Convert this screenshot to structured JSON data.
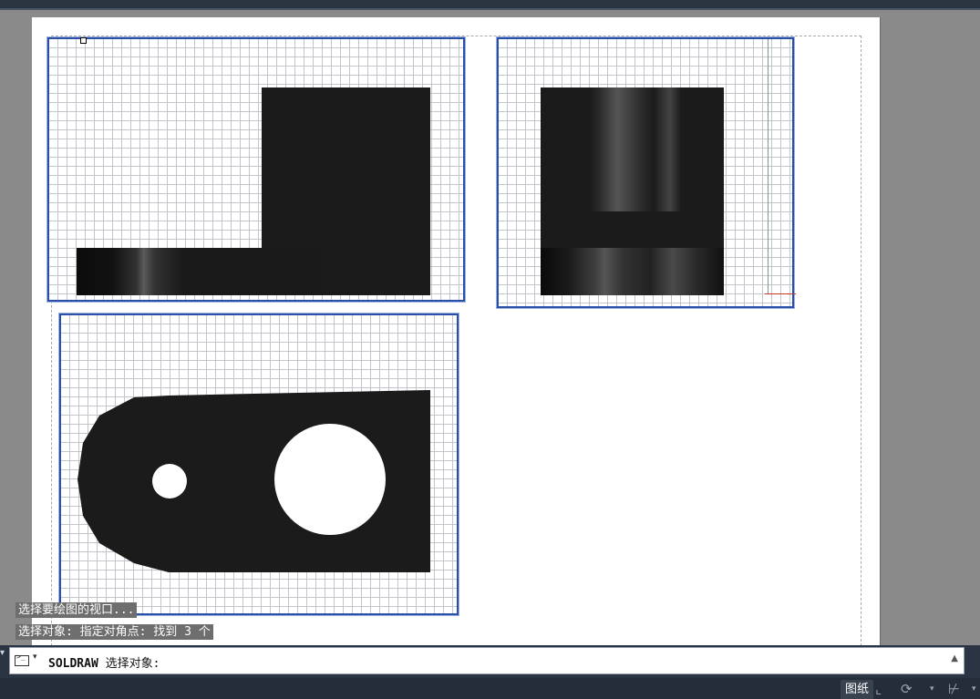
{
  "command_history": [
    "选择要绘图的视口...",
    "选择对象: 指定对角点: 找到 3 个"
  ],
  "command_line": {
    "command": "SOLDRAW",
    "prompt": " 选择对象:",
    "prompt_icon": ">_",
    "dropdown_icon": "▾",
    "scroll_icon": "▲"
  },
  "status_bar": {
    "space_label": "图纸",
    "icons": [
      "snap-mode-icon",
      "polar-tracking-icon",
      "object-snap-icon"
    ],
    "glyphs": {
      "snap": "⌞",
      "polar": "⟳",
      "osnap": "⊬",
      "dropdown": "▾"
    }
  },
  "colors": {
    "viewport_border": "#2a4fa8",
    "solid_fill": "#1b1b1b",
    "paper": "#ffffff",
    "background": "#8a8a8a",
    "command_strip": "#2b3442"
  }
}
